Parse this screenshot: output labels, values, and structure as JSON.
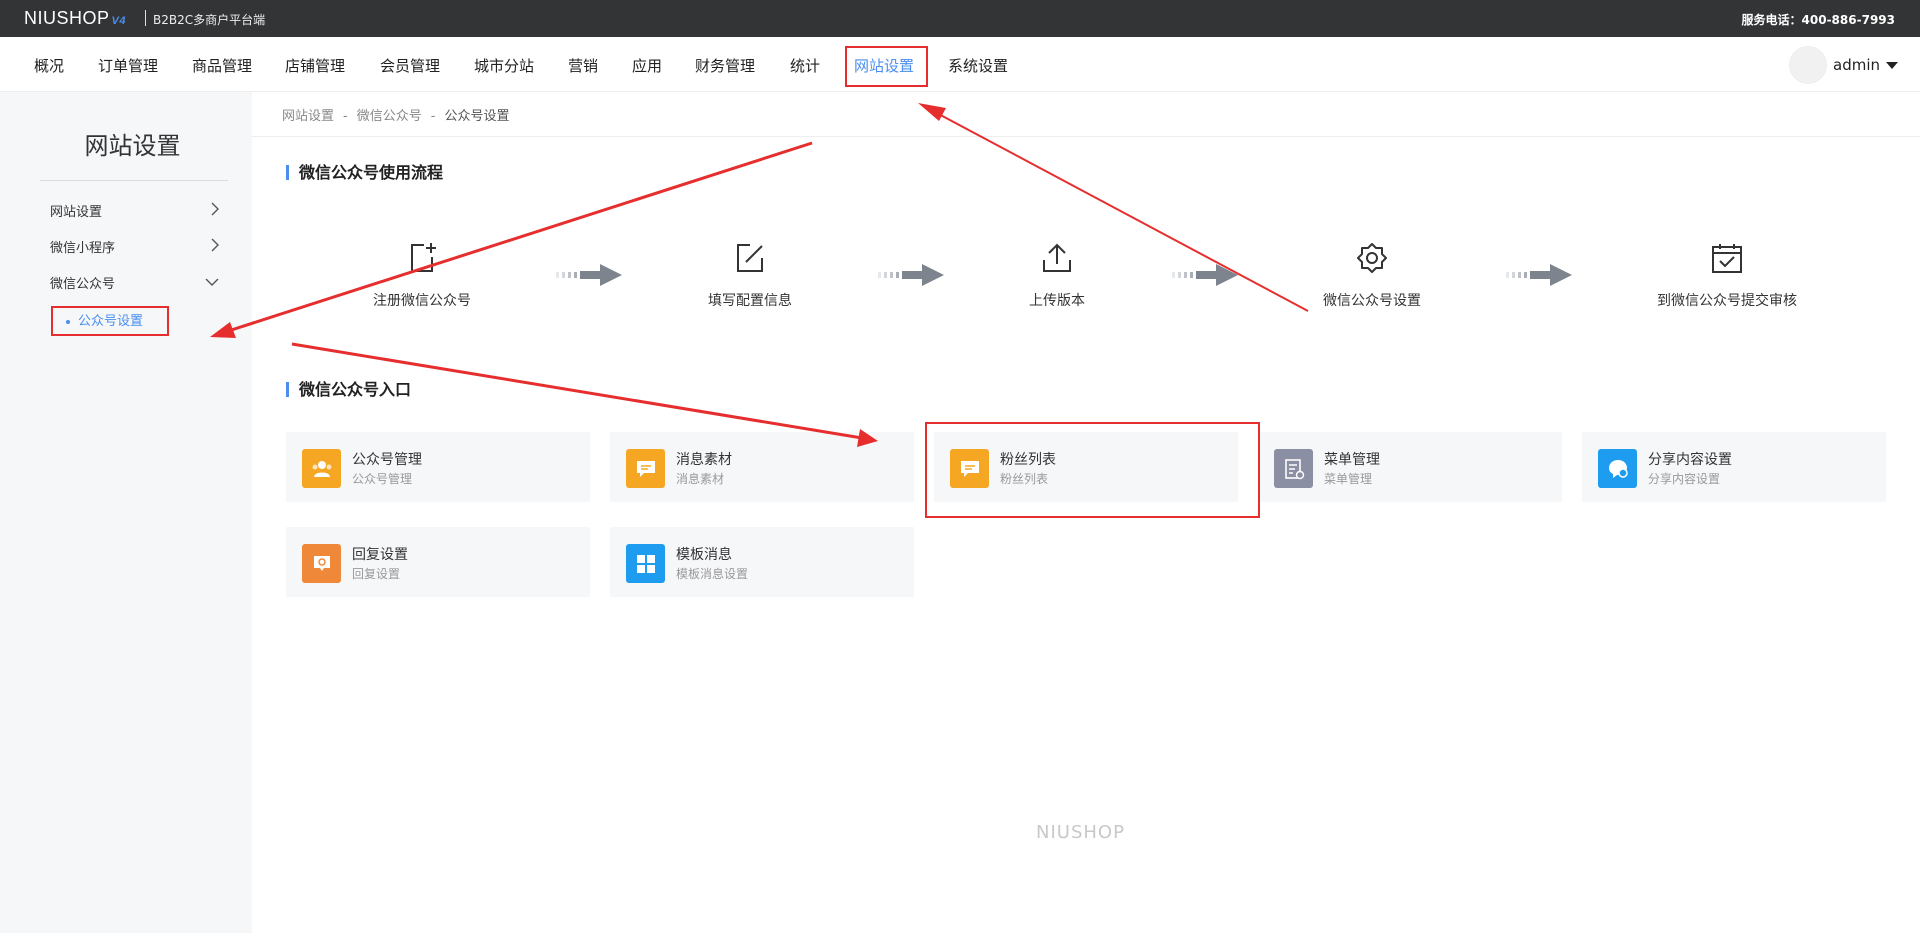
{
  "header": {
    "logo": "NIUSHOP",
    "logo_version": "V4",
    "subtitle": "B2B2C多商户平台端",
    "hotline": "服务电话：400-886-7993"
  },
  "nav": {
    "items": [
      "概况",
      "订单管理",
      "商品管理",
      "店铺管理",
      "会员管理",
      "城市分站",
      "营销",
      "应用",
      "财务管理",
      "统计",
      "网站设置",
      "系统设置"
    ],
    "active": "网站设置",
    "user": "admin"
  },
  "sidebar": {
    "title": "网站设置",
    "items": [
      "网站设置",
      "微信小程序",
      "微信公众号"
    ],
    "sub_item": "公众号设置"
  },
  "breadcrumb": [
    "网站设置",
    "微信公众号",
    "公众号设置"
  ],
  "process": {
    "title": "微信公众号使用流程",
    "steps": [
      "注册微信公众号",
      "填写配置信息",
      "上传版本",
      "微信公众号设置",
      "到微信公众号提交审核"
    ]
  },
  "entry": {
    "title": "微信公众号入口",
    "cards": [
      {
        "title": "公众号管理",
        "desc": "公众号管理",
        "color": "#f5a623",
        "icon": "users-icon"
      },
      {
        "title": "消息素材",
        "desc": "消息素材",
        "color": "#f5a623",
        "icon": "message-icon"
      },
      {
        "title": "粉丝列表",
        "desc": "粉丝列表",
        "color": "#f5a623",
        "icon": "chat-icon"
      },
      {
        "title": "菜单管理",
        "desc": "菜单管理",
        "color": "#8a8fa3",
        "icon": "menu-icon"
      },
      {
        "title": "分享内容设置",
        "desc": "分享内容设置",
        "color": "#1e9cf0",
        "icon": "share-icon"
      },
      {
        "title": "回复设置",
        "desc": "回复设置",
        "color": "#f0883a",
        "icon": "reply-icon"
      },
      {
        "title": "模板消息",
        "desc": "模板消息设置",
        "color": "#1e9cf0",
        "icon": "template-icon"
      }
    ]
  },
  "footer": {
    "logo": "NIUSHOP"
  },
  "colors": {
    "accent": "#4a8ef0",
    "annotation": "#e62e2e"
  }
}
